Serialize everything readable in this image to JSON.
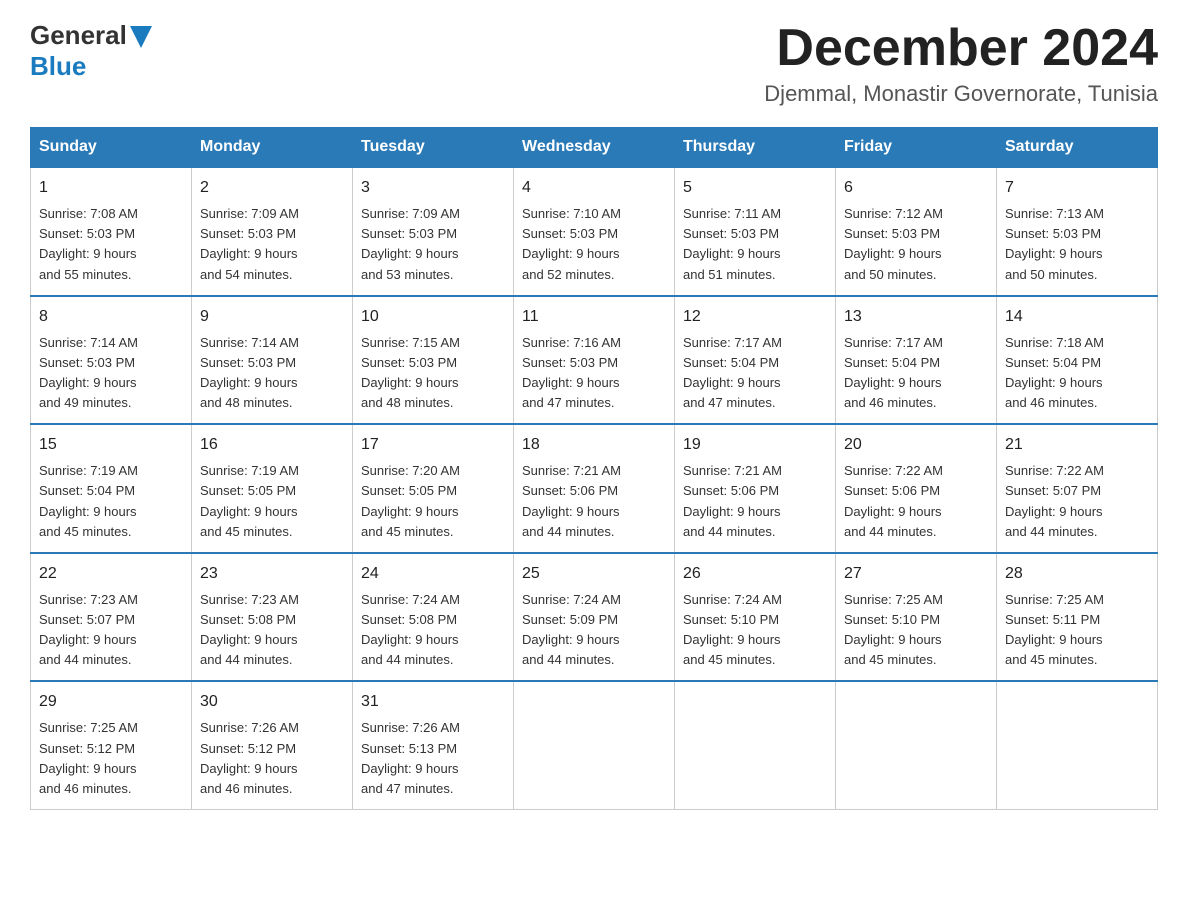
{
  "logo": {
    "general": "General",
    "triangle": "▶",
    "blue": "Blue"
  },
  "title": {
    "month_year": "December 2024",
    "location": "Djemmal, Monastir Governorate, Tunisia"
  },
  "headers": [
    "Sunday",
    "Monday",
    "Tuesday",
    "Wednesday",
    "Thursday",
    "Friday",
    "Saturday"
  ],
  "weeks": [
    [
      {
        "day": "1",
        "sunrise": "7:08 AM",
        "sunset": "5:03 PM",
        "daylight": "9 hours and 55 minutes."
      },
      {
        "day": "2",
        "sunrise": "7:09 AM",
        "sunset": "5:03 PM",
        "daylight": "9 hours and 54 minutes."
      },
      {
        "day": "3",
        "sunrise": "7:09 AM",
        "sunset": "5:03 PM",
        "daylight": "9 hours and 53 minutes."
      },
      {
        "day": "4",
        "sunrise": "7:10 AM",
        "sunset": "5:03 PM",
        "daylight": "9 hours and 52 minutes."
      },
      {
        "day": "5",
        "sunrise": "7:11 AM",
        "sunset": "5:03 PM",
        "daylight": "9 hours and 51 minutes."
      },
      {
        "day": "6",
        "sunrise": "7:12 AM",
        "sunset": "5:03 PM",
        "daylight": "9 hours and 50 minutes."
      },
      {
        "day": "7",
        "sunrise": "7:13 AM",
        "sunset": "5:03 PM",
        "daylight": "9 hours and 50 minutes."
      }
    ],
    [
      {
        "day": "8",
        "sunrise": "7:14 AM",
        "sunset": "5:03 PM",
        "daylight": "9 hours and 49 minutes."
      },
      {
        "day": "9",
        "sunrise": "7:14 AM",
        "sunset": "5:03 PM",
        "daylight": "9 hours and 48 minutes."
      },
      {
        "day": "10",
        "sunrise": "7:15 AM",
        "sunset": "5:03 PM",
        "daylight": "9 hours and 48 minutes."
      },
      {
        "day": "11",
        "sunrise": "7:16 AM",
        "sunset": "5:03 PM",
        "daylight": "9 hours and 47 minutes."
      },
      {
        "day": "12",
        "sunrise": "7:17 AM",
        "sunset": "5:04 PM",
        "daylight": "9 hours and 47 minutes."
      },
      {
        "day": "13",
        "sunrise": "7:17 AM",
        "sunset": "5:04 PM",
        "daylight": "9 hours and 46 minutes."
      },
      {
        "day": "14",
        "sunrise": "7:18 AM",
        "sunset": "5:04 PM",
        "daylight": "9 hours and 46 minutes."
      }
    ],
    [
      {
        "day": "15",
        "sunrise": "7:19 AM",
        "sunset": "5:04 PM",
        "daylight": "9 hours and 45 minutes."
      },
      {
        "day": "16",
        "sunrise": "7:19 AM",
        "sunset": "5:05 PM",
        "daylight": "9 hours and 45 minutes."
      },
      {
        "day": "17",
        "sunrise": "7:20 AM",
        "sunset": "5:05 PM",
        "daylight": "9 hours and 45 minutes."
      },
      {
        "day": "18",
        "sunrise": "7:21 AM",
        "sunset": "5:06 PM",
        "daylight": "9 hours and 44 minutes."
      },
      {
        "day": "19",
        "sunrise": "7:21 AM",
        "sunset": "5:06 PM",
        "daylight": "9 hours and 44 minutes."
      },
      {
        "day": "20",
        "sunrise": "7:22 AM",
        "sunset": "5:06 PM",
        "daylight": "9 hours and 44 minutes."
      },
      {
        "day": "21",
        "sunrise": "7:22 AM",
        "sunset": "5:07 PM",
        "daylight": "9 hours and 44 minutes."
      }
    ],
    [
      {
        "day": "22",
        "sunrise": "7:23 AM",
        "sunset": "5:07 PM",
        "daylight": "9 hours and 44 minutes."
      },
      {
        "day": "23",
        "sunrise": "7:23 AM",
        "sunset": "5:08 PM",
        "daylight": "9 hours and 44 minutes."
      },
      {
        "day": "24",
        "sunrise": "7:24 AM",
        "sunset": "5:08 PM",
        "daylight": "9 hours and 44 minutes."
      },
      {
        "day": "25",
        "sunrise": "7:24 AM",
        "sunset": "5:09 PM",
        "daylight": "9 hours and 44 minutes."
      },
      {
        "day": "26",
        "sunrise": "7:24 AM",
        "sunset": "5:10 PM",
        "daylight": "9 hours and 45 minutes."
      },
      {
        "day": "27",
        "sunrise": "7:25 AM",
        "sunset": "5:10 PM",
        "daylight": "9 hours and 45 minutes."
      },
      {
        "day": "28",
        "sunrise": "7:25 AM",
        "sunset": "5:11 PM",
        "daylight": "9 hours and 45 minutes."
      }
    ],
    [
      {
        "day": "29",
        "sunrise": "7:25 AM",
        "sunset": "5:12 PM",
        "daylight": "9 hours and 46 minutes."
      },
      {
        "day": "30",
        "sunrise": "7:26 AM",
        "sunset": "5:12 PM",
        "daylight": "9 hours and 46 minutes."
      },
      {
        "day": "31",
        "sunrise": "7:26 AM",
        "sunset": "5:13 PM",
        "daylight": "9 hours and 47 minutes."
      },
      null,
      null,
      null,
      null
    ]
  ],
  "labels": {
    "sunrise": "Sunrise:",
    "sunset": "Sunset:",
    "daylight": "Daylight:"
  },
  "colors": {
    "header_bg": "#2a7ab8",
    "header_text": "#ffffff",
    "border_top": "#2a7ab8"
  }
}
